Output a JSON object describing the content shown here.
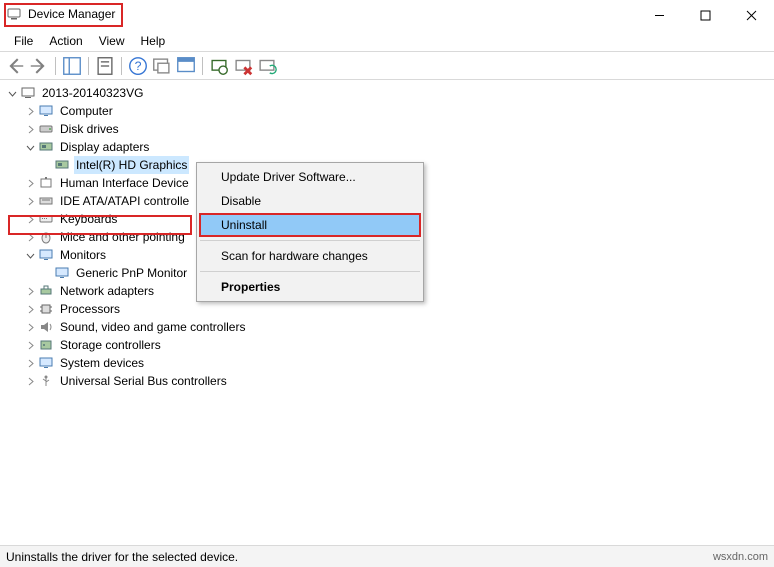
{
  "window": {
    "title": "Device Manager"
  },
  "menu": {
    "file": "File",
    "action": "Action",
    "view": "View",
    "help": "Help"
  },
  "tree": {
    "root": "2013-20140323VG",
    "computer": "Computer",
    "disk_drives": "Disk drives",
    "display_adapters": "Display adapters",
    "intel_hd": "Intel(R) HD Graphics",
    "hid": "Human Interface Device",
    "ide": "IDE ATA/ATAPI controlle",
    "keyboards": "Keyboards",
    "mice": "Mice and other pointing",
    "monitors": "Monitors",
    "generic_pnp": "Generic PnP Monitor",
    "network": "Network adapters",
    "processors": "Processors",
    "sound": "Sound, video and game controllers",
    "storage": "Storage controllers",
    "system": "System devices",
    "usb": "Universal Serial Bus controllers"
  },
  "context_menu": {
    "update": "Update Driver Software...",
    "disable": "Disable",
    "uninstall": "Uninstall",
    "scan": "Scan for hardware changes",
    "properties": "Properties"
  },
  "status": {
    "text": "Uninstalls the driver for the selected device.",
    "watermark": "wsxdn.com"
  }
}
